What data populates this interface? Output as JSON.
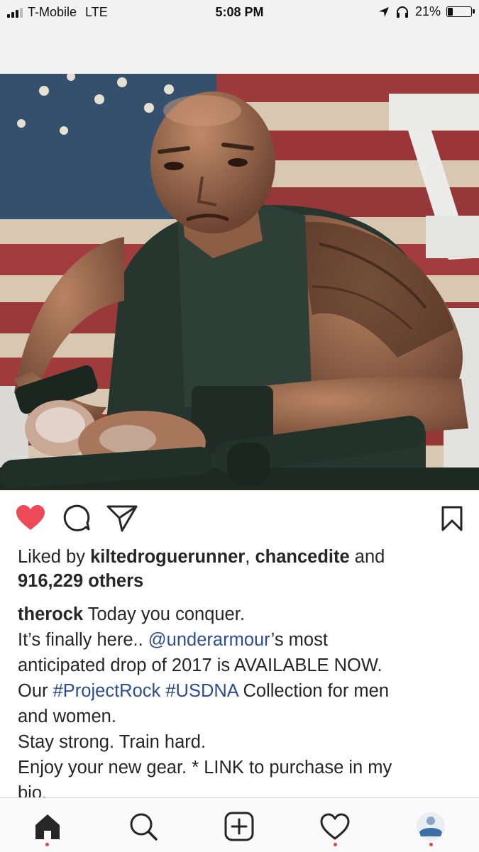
{
  "status_bar": {
    "carrier": "T-Mobile",
    "network": "LTE",
    "time": "5:08 PM",
    "battery_percent": "21%",
    "battery_level": 0.21
  },
  "post": {
    "liked": true,
    "likes": {
      "prefix": "Liked by",
      "user1": "kiltedroguerunner",
      "sep": ",",
      "user2": "chancedite",
      "and": "and",
      "count": "916,229 others"
    },
    "caption": {
      "username": "therock",
      "line1": "Today you conquer.",
      "line2_a": "It’s finally here..",
      "mention": "@underarmour",
      "line2_b": "’s most",
      "line3": "anticipated drop of 2017 is AVAILABLE NOW.",
      "line4_a": "Our",
      "hashtag1": "#ProjectRock",
      "hashtag2": "#USDNA",
      "line4_b": "Collection for men",
      "line5": "and women.",
      "line6": "Stay strong. Train hard.",
      "line7": "Enjoy your new gear. * LINK to purchase in my",
      "line8": "bio."
    }
  },
  "icons": {
    "like": "heart-filled-icon",
    "comment": "comment-icon",
    "share": "paper-plane-icon",
    "save": "bookmark-icon"
  },
  "tab_bar": [
    "home-icon",
    "search-icon",
    "add-post-icon",
    "activity-heart-icon",
    "profile-avatar"
  ],
  "colors": {
    "heart": "#ed4956",
    "link": "#2c4d8f",
    "notification_dot": "#e8404a"
  }
}
